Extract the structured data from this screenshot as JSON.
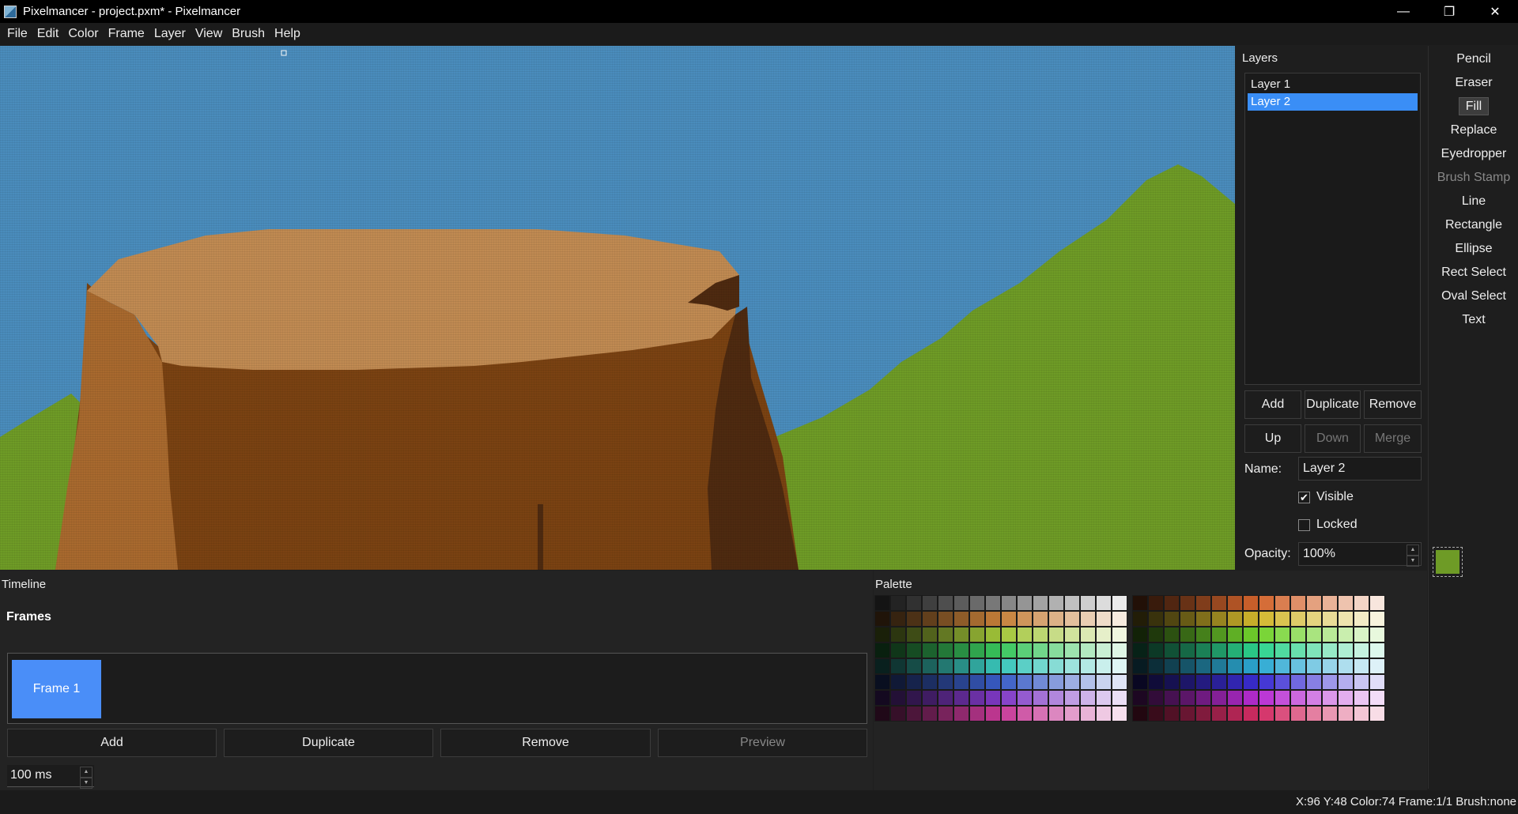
{
  "window": {
    "title": "Pixelmancer - project.pxm* - Pixelmancer",
    "minimize_glyph": "—",
    "restore_glyph": "❐",
    "close_glyph": "✕"
  },
  "menu": [
    "File",
    "Edit",
    "Color",
    "Frame",
    "Layer",
    "View",
    "Brush",
    "Help"
  ],
  "layers": {
    "title": "Layers",
    "items": [
      {
        "label": "Layer 1",
        "selected": false
      },
      {
        "label": "Layer 2",
        "selected": true
      }
    ],
    "buttons": {
      "add": "Add",
      "duplicate": "Duplicate",
      "remove": "Remove",
      "up": "Up",
      "down": "Down",
      "merge": "Merge"
    },
    "name_label": "Name:",
    "name_value": "Layer 2",
    "visible_label": "Visible",
    "visible_checked": true,
    "locked_label": "Locked",
    "locked_checked": false,
    "opacity_label": "Opacity:",
    "opacity_value": "100%"
  },
  "tools": {
    "items": [
      "Pencil",
      "Eraser",
      "Fill",
      "Replace",
      "Eyedropper",
      "Brush Stamp",
      "Line",
      "Rectangle",
      "Ellipse",
      "Rect Select",
      "Oval Select",
      "Text"
    ],
    "active": "Fill",
    "disabled": [
      "Brush Stamp"
    ],
    "current_color": "#6e9b26"
  },
  "timeline": {
    "title": "Timeline",
    "frames_title": "Frames",
    "frames": [
      "Frame 1"
    ],
    "buttons": {
      "add": "Add",
      "duplicate": "Duplicate",
      "remove": "Remove",
      "preview": "Preview"
    },
    "frame_duration": "100 ms"
  },
  "palette": {
    "title": "Palette"
  },
  "status": "X:96 Y:48  Color:74  Frame:1/1  Brush:none",
  "canvas": {
    "sky_color": "#4a8cbc",
    "grass_color": "#6e9b26",
    "stump_top_color": "#c08a52",
    "stump_side_color": "#7a4212",
    "stump_shadow_color": "#4e2a10",
    "stump_light_color": "#a8692e"
  }
}
